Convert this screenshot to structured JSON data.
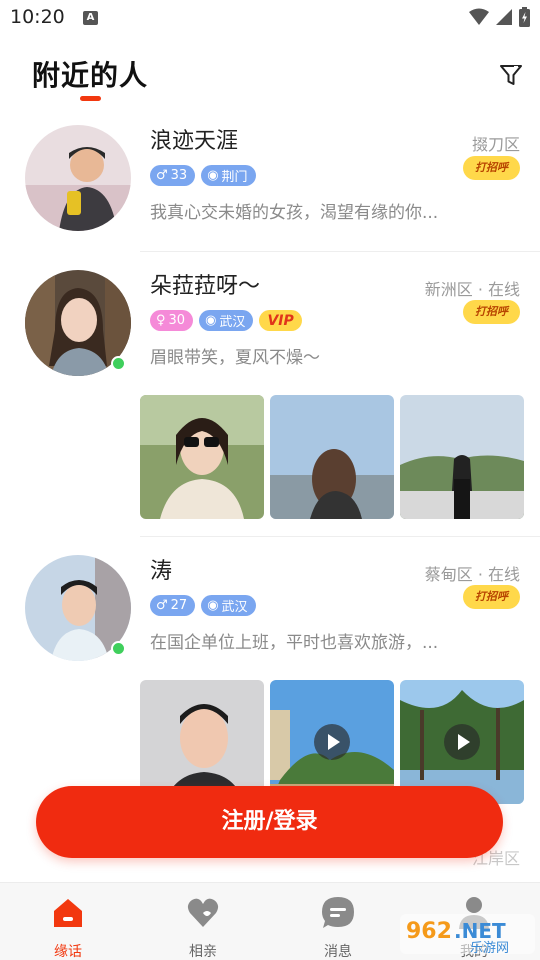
{
  "status_bar": {
    "time": "10:20",
    "notification_letter": "A"
  },
  "header": {
    "title": "附近的人"
  },
  "users": [
    {
      "name": "浪迹天涯",
      "location": "掇刀区",
      "greet_label": "打招呼",
      "gender": "male",
      "age": "33",
      "city": "荆门",
      "bio": "我真心交未婚的女孩，渴望有缘的你..."
    },
    {
      "name": "朵菈菈呀～",
      "location": "新洲区 · 在线",
      "greet_label": "打招呼",
      "gender": "female",
      "age": "30",
      "city": "武汉",
      "vip": "VIP",
      "bio": "眉眼带笑，夏风不燥～"
    },
    {
      "name": "涛",
      "location": "蔡甸区 · 在线",
      "greet_label": "打招呼",
      "gender": "male",
      "age": "27",
      "city": "武汉",
      "bio": "在国企单位上班，平时也喜欢旅游，..."
    }
  ],
  "register_button": {
    "label": "注册/登录"
  },
  "partial_next_user": {
    "location": "江岸区"
  },
  "bottom_nav": [
    {
      "label": "缘话",
      "icon": "home-icon",
      "active": true
    },
    {
      "label": "相亲",
      "icon": "heart-icon",
      "active": false
    },
    {
      "label": "消息",
      "icon": "message-icon",
      "active": false
    },
    {
      "label": "我的",
      "icon": "profile-icon",
      "active": false
    }
  ],
  "watermark": {
    "brand": "962.NET",
    "sub": "乐游网"
  },
  "colors": {
    "accent": "#f2380f",
    "greet_bg": "#ffd84a",
    "male_tag": "#7aa6f0",
    "female_tag": "#f58ad8",
    "online": "#3fcf5c"
  }
}
